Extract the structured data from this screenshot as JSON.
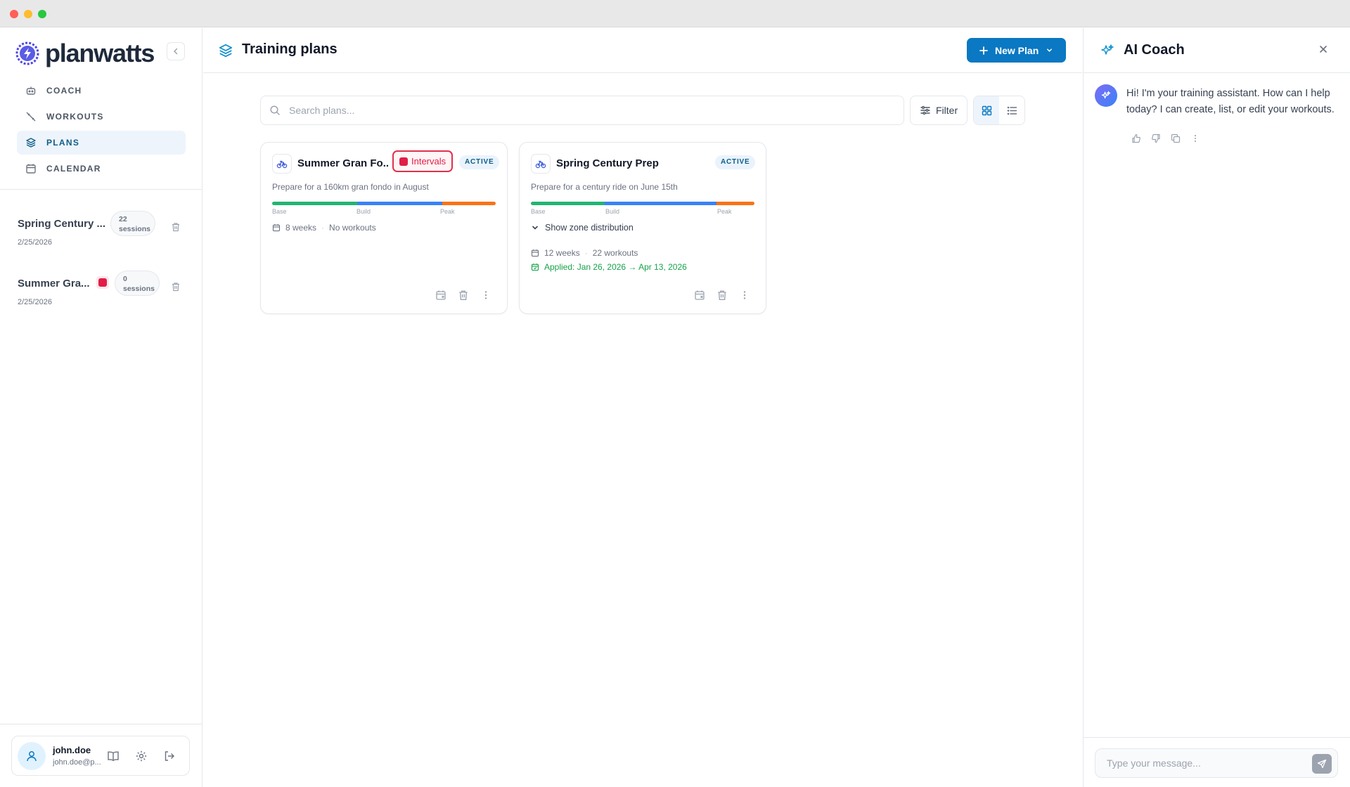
{
  "brand": {
    "name": "planwatts"
  },
  "nav": [
    {
      "label": "COACH",
      "icon": "robot-icon"
    },
    {
      "label": "WORKOUTS",
      "icon": "workouts-icon"
    },
    {
      "label": "PLANS",
      "icon": "layers-icon",
      "active": true
    },
    {
      "label": "CALENDAR",
      "icon": "calendar-icon"
    }
  ],
  "sidebar_plans": [
    {
      "name": "Spring Century ...",
      "date": "2/25/2026",
      "sessions_count": "22",
      "sessions_label": "sessions",
      "intervals": false
    },
    {
      "name": "Summer Gra...",
      "date": "2/25/2026",
      "sessions_count": "0",
      "sessions_label": "sessions",
      "intervals": true
    }
  ],
  "user": {
    "name": "john.doe",
    "email": "john.doe@p..."
  },
  "header": {
    "title": "Training plans",
    "new_plan_label": "New Plan"
  },
  "search": {
    "placeholder": "Search plans..."
  },
  "filter": {
    "label": "Filter"
  },
  "view_mode": "grid",
  "plans": [
    {
      "title": "Summer Gran Fo...",
      "badge": "ACTIVE",
      "intervals_label": "Intervals",
      "description": "Prepare for a 160km gran fondo in August",
      "phases": [
        "Base",
        "Build",
        "Peak"
      ],
      "phase_colors": [
        "#22b573",
        "#3b82f6",
        "#f97316"
      ],
      "phase_fractions": [
        0.38,
        0.38,
        0.24
      ],
      "weeks": "8 weeks",
      "workouts": "No workouts"
    },
    {
      "title": "Spring Century Prep",
      "badge": "ACTIVE",
      "description": "Prepare for a century ride on June 15th",
      "phases": [
        "Base",
        "Build",
        "Peak"
      ],
      "phase_colors": [
        "#22b573",
        "#3b82f6",
        "#f97316"
      ],
      "phase_fractions": [
        0.33,
        0.5,
        0.17
      ],
      "zone_toggle": "Show zone distribution",
      "weeks": "12 weeks",
      "workouts": "22 workouts",
      "applied": "Applied: Jan 26, 2026 → Apr 13, 2026"
    }
  ],
  "coach": {
    "title": "AI Coach",
    "message": "Hi! I'm your training assistant. How can I help today? I can create, list, or edit your workouts.",
    "input_placeholder": "Type your message..."
  },
  "colors": {
    "accent": "#0a78c2",
    "intervals": "#e11d48",
    "success": "#16a34a"
  }
}
